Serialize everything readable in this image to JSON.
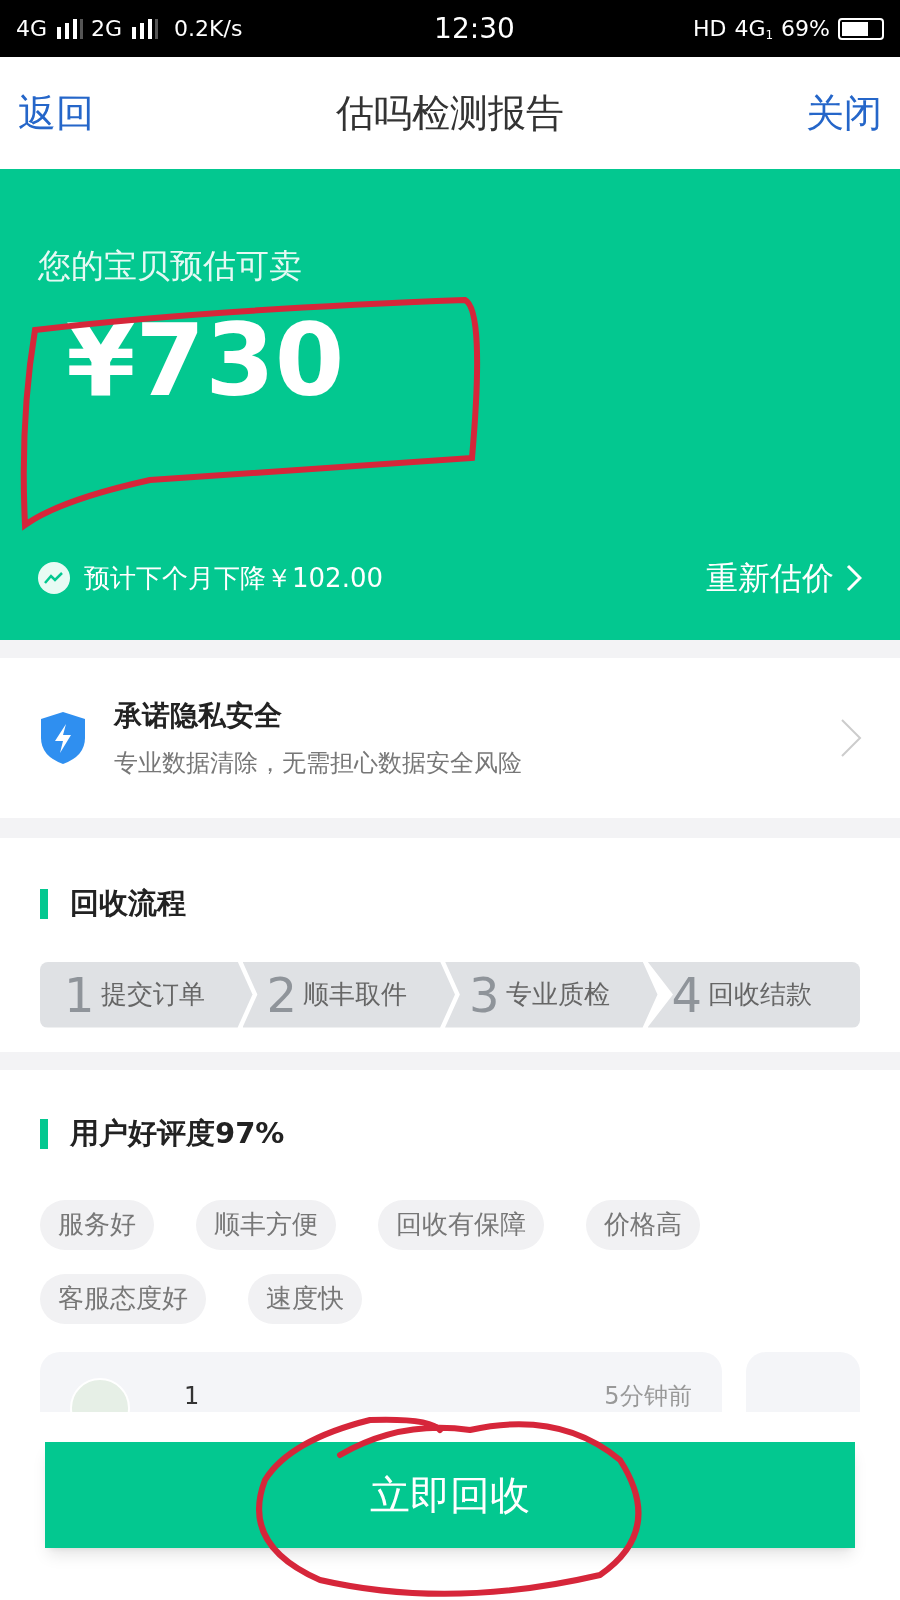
{
  "status_bar": {
    "left": [
      "4G",
      "2G",
      "0.2K/s"
    ],
    "time": "12:30",
    "hd": "HD",
    "network": "4G",
    "sim": "1",
    "battery_text": "69%"
  },
  "nav": {
    "back": "返回",
    "title": "估吗检测报告",
    "close": "关闭"
  },
  "estimate": {
    "label": "您的宝贝预估可卖",
    "price": "¥730",
    "trend": "预计下个月下降￥102.00",
    "reestimate": "重新估价"
  },
  "privacy": {
    "title": "承诺隐私安全",
    "subtitle": "专业数据清除，无需担心数据安全风险"
  },
  "process": {
    "heading": "回收流程",
    "steps": [
      {
        "number": "1",
        "label": "提交订单"
      },
      {
        "number": "2",
        "label": "顺丰取件"
      },
      {
        "number": "3",
        "label": "专业质检"
      },
      {
        "number": "4",
        "label": "回收结款"
      }
    ]
  },
  "reviews": {
    "heading": "用户好评度97%",
    "tag_rows": [
      [
        "服务好",
        "顺丰方便",
        "回收有保障",
        "价格高"
      ],
      [
        "客服态度好",
        "速度快"
      ]
    ],
    "cards": [
      {
        "user": "1",
        "time": "5分钟前"
      },
      {
        "kind": "partial"
      }
    ]
  },
  "action": {
    "label": "立即回收"
  }
}
